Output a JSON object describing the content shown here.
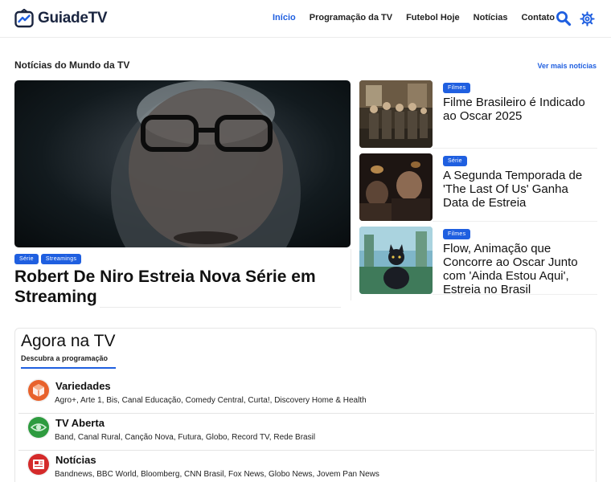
{
  "header": {
    "logo_text": "GuiadeTV",
    "nav": [
      {
        "label": "Início",
        "active": true
      },
      {
        "label": "Programação da TV",
        "active": false
      },
      {
        "label": "Futebol Hoje",
        "active": false
      },
      {
        "label": "Notícias",
        "active": false
      },
      {
        "label": "Contato",
        "active": false
      }
    ],
    "icons": [
      "search-icon",
      "gear-icon"
    ]
  },
  "news": {
    "section_title": "Notícias do Mundo da TV",
    "see_more": "Ver mais notícias",
    "featured": {
      "tags": [
        "Série",
        "Streamings"
      ],
      "title": "Robert De Niro Estreia Nova Série em Streaming"
    },
    "cards": [
      {
        "tag": "Filmes",
        "title": "Filme Brasileiro é Indicado ao Oscar 2025"
      },
      {
        "tag": "Série",
        "title": "A Segunda Temporada de 'The Last Of Us' Ganha Data de Estreia"
      },
      {
        "tag": "Filmes",
        "title": "Flow, Animação que Concorre ao Oscar Junto com 'Ainda Estou Aqui', Estreia no Brasil"
      }
    ]
  },
  "tv_now": {
    "title": "Agora na TV",
    "subtitle": "Descubra a programação",
    "categories": [
      {
        "name": "Variedades",
        "channels": "Agro+, Arte 1, Bis, Canal Educação, Comedy Central, Curta!, Discovery Home & Health",
        "icon": "box-icon",
        "color": "#e8622c"
      },
      {
        "name": "TV Aberta",
        "channels": "Band, Canal Rural, Canção Nova, Futura, Globo, Record TV, Rede Brasil",
        "icon": "eye-icon",
        "color": "#2e9b3f"
      },
      {
        "name": "Notícias",
        "channels": "Bandnews, BBC World, Bloomberg, CNN Brasil, Fox News, Globo News, Jovem Pan News",
        "icon": "newspaper-icon",
        "color": "#d42a2a"
      }
    ]
  },
  "colors": {
    "accent": "#1f5fe0",
    "logo_dark": "#1a2540"
  }
}
